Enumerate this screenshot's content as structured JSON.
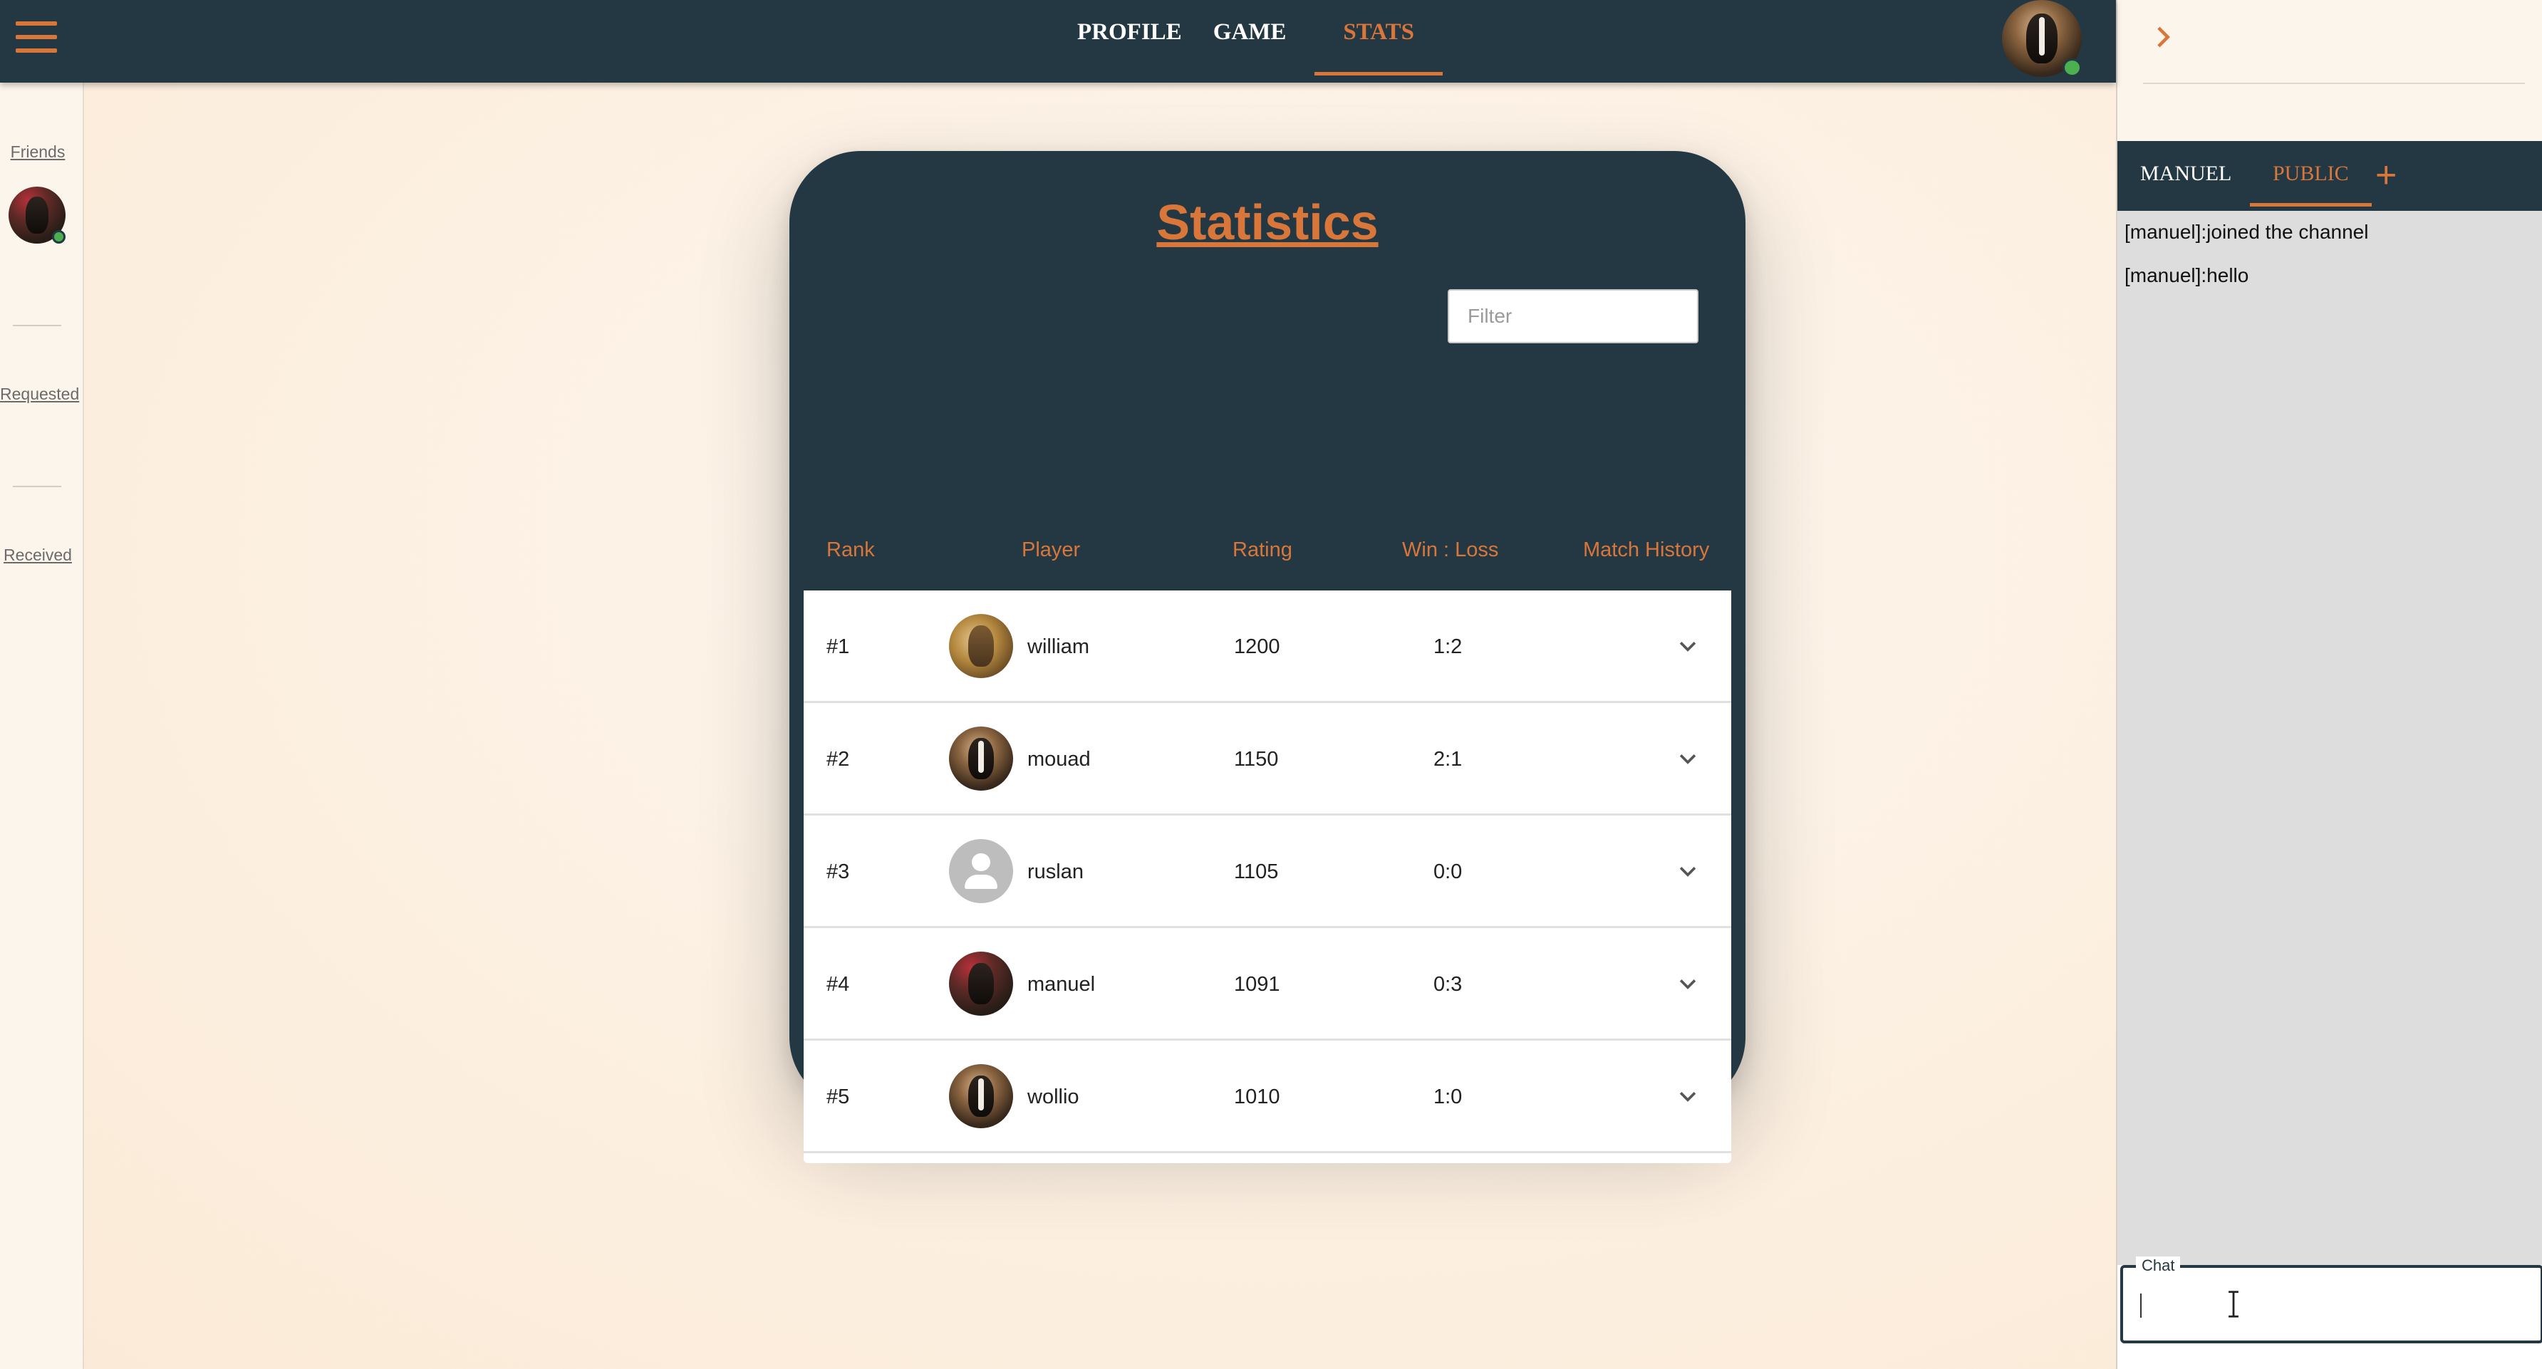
{
  "nav": {
    "items": [
      {
        "label": "PROFILE",
        "active": false
      },
      {
        "label": "GAME",
        "active": false
      },
      {
        "label": "STATS",
        "active": true
      }
    ]
  },
  "sidebar": {
    "friends_label": "Friends",
    "requested_label": "Requested",
    "received_label": "Received"
  },
  "stats": {
    "title": "Statistics",
    "filter_placeholder": "Filter",
    "columns": [
      "Rank",
      "Player",
      "Rating",
      "Win : Loss",
      "Match History"
    ],
    "rows": [
      {
        "rank": "#1",
        "player": "william",
        "rating": "1200",
        "win_loss": "1:2",
        "avatar": "gold"
      },
      {
        "rank": "#2",
        "player": "mouad",
        "rating": "1150",
        "win_loss": "2:1",
        "avatar": "goat"
      },
      {
        "rank": "#3",
        "player": "ruslan",
        "rating": "1105",
        "win_loss": "0:0",
        "avatar": "default"
      },
      {
        "rank": "#4",
        "player": "manuel",
        "rating": "1091",
        "win_loss": "0:3",
        "avatar": "red"
      },
      {
        "rank": "#5",
        "player": "wollio",
        "rating": "1010",
        "win_loss": "1:0",
        "avatar": "goat"
      }
    ]
  },
  "chat": {
    "tabs": [
      {
        "label": "MANUEL",
        "active": false
      },
      {
        "label": "PUBLIC",
        "active": true
      }
    ],
    "add_icon": "plus-icon",
    "messages": [
      "[manuel]:joined the channel",
      "[manuel]:hello"
    ],
    "input_label": "Chat",
    "input_value": ""
  },
  "colors": {
    "primary": "#233843",
    "accent": "#d9763a",
    "online": "#4caf50"
  }
}
